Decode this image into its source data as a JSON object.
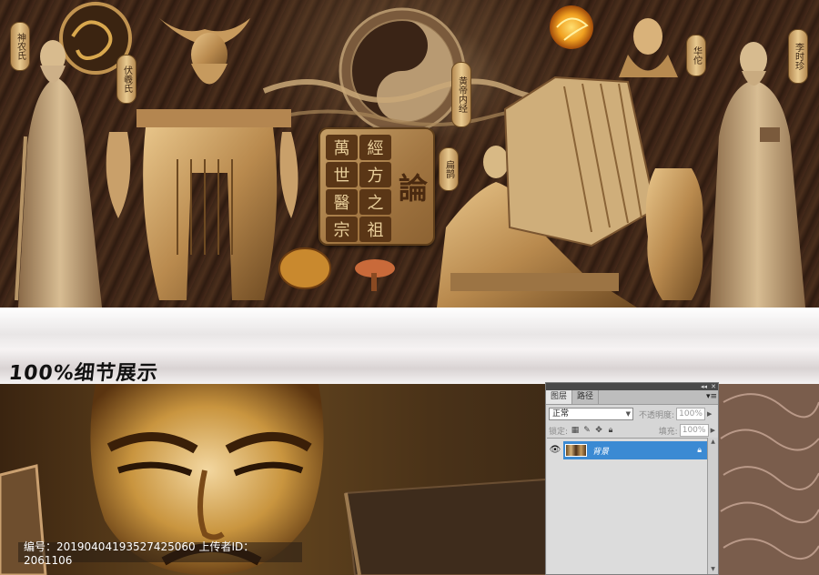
{
  "mural": {
    "badges": [
      "神农氏",
      "伏羲氏",
      "华佗",
      "李时珍",
      "扁鹊",
      "张仲景"
    ],
    "center_badge": "黄帝内经",
    "seal_chars": [
      "萬",
      "經",
      "世",
      "方",
      "醫",
      "之",
      "宗",
      "祖"
    ],
    "seal_big": "論"
  },
  "band": {
    "title": "100%细节展示"
  },
  "watermark": {
    "text": "编号：20190404193527425060 上传者ID：2061106"
  },
  "layers_panel": {
    "tabs": [
      "图层",
      "路径"
    ],
    "blend_mode": "正常",
    "opacity_label": "不透明度:",
    "opacity_value": "100%",
    "lock_label": "锁定:",
    "fill_label": "填充:",
    "fill_value": "100%",
    "layer_name": "背景"
  }
}
